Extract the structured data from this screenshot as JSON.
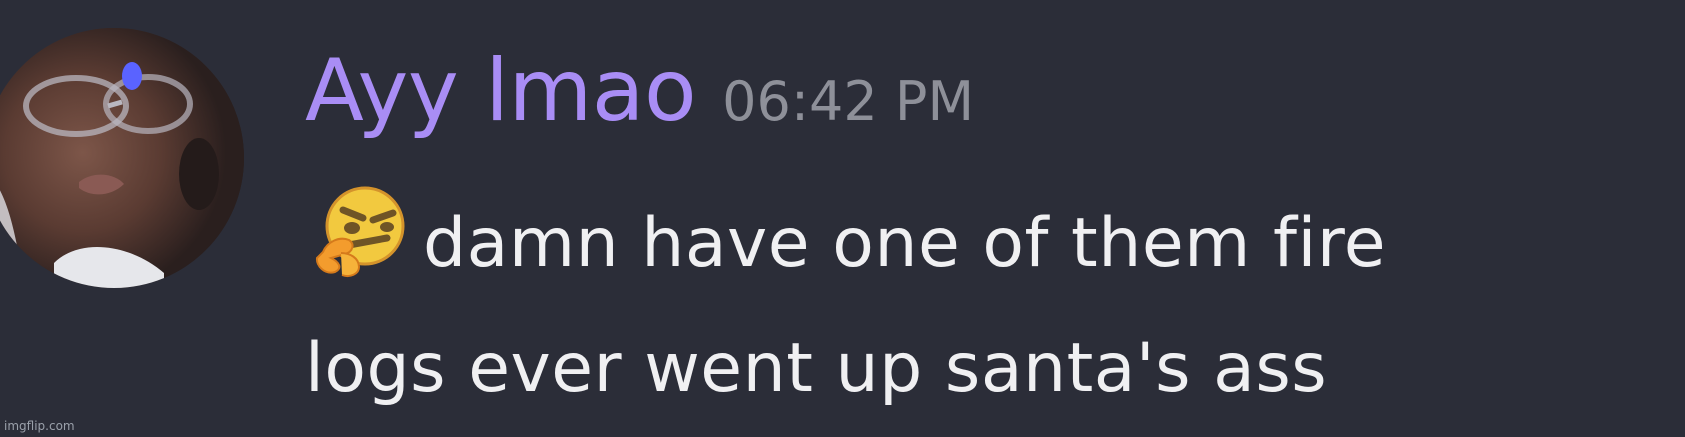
{
  "message": {
    "author": "Ayy lmao",
    "timestamp": "06:42 PM",
    "emoji": "thinking-face",
    "text_line1": "damn have one of them fire",
    "text_line2": "logs ever went up santa's ass"
  },
  "colors": {
    "background": "#2b2d38",
    "username": "#a98df5",
    "timestamp": "#8e9099",
    "text": "#f0f0f2"
  },
  "watermark": "imgflip.com"
}
